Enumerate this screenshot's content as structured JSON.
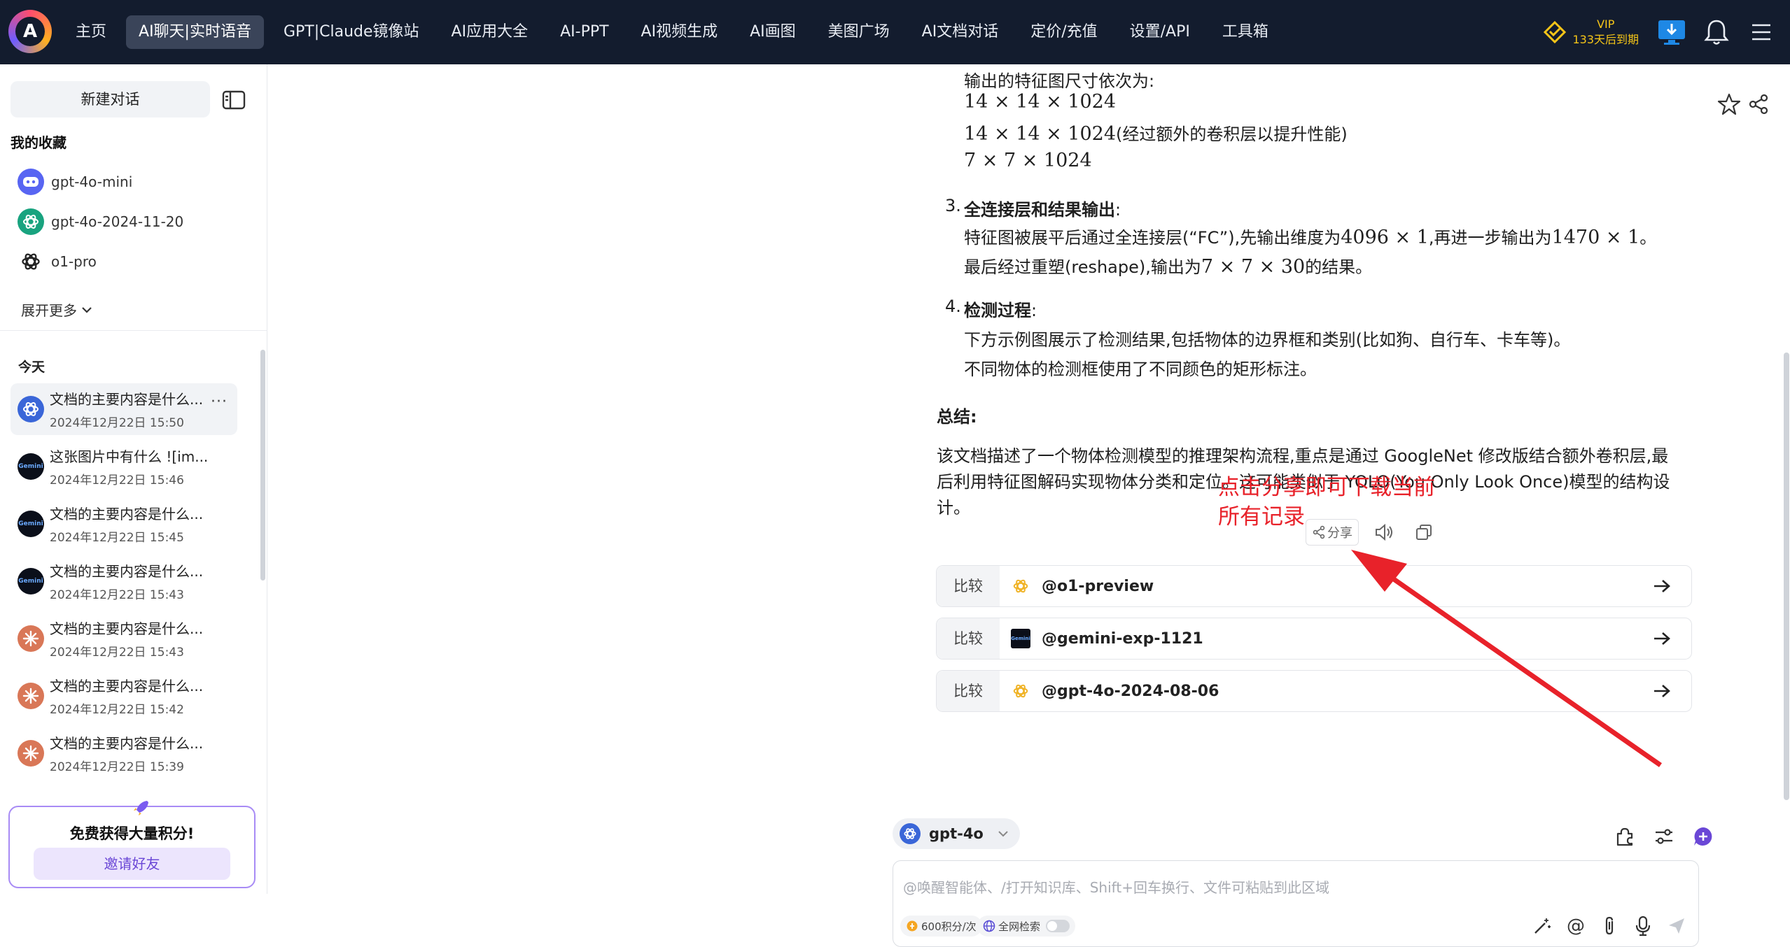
{
  "topnav": {
    "logo_letter": "A",
    "items": [
      {
        "label": "主页",
        "active": false
      },
      {
        "label": "AI聊天|实时语音",
        "active": true
      },
      {
        "label": "GPT|Claude镜像站",
        "active": false
      },
      {
        "label": "AI应用大全",
        "active": false
      },
      {
        "label": "AI-PPT",
        "active": false
      },
      {
        "label": "AI视频生成",
        "active": false
      },
      {
        "label": "AI画图",
        "active": false
      },
      {
        "label": "美图广场",
        "active": false
      },
      {
        "label": "AI文档对话",
        "active": false
      },
      {
        "label": "定价/充值",
        "active": false
      },
      {
        "label": "设置/API",
        "active": false
      },
      {
        "label": "工具箱",
        "active": false
      }
    ],
    "vip_label": "VIP",
    "vip_expiry": "133天后到期"
  },
  "sidebar": {
    "new_chat_label": "新建对话",
    "favorites_title": "我的收藏",
    "favorites": [
      {
        "label": "gpt-4o-mini",
        "icon": "discord-bot-icon"
      },
      {
        "label": "gpt-4o-2024-11-20",
        "icon": "openai-icon"
      },
      {
        "label": "o1-pro",
        "icon": "openai-icon"
      }
    ],
    "expand_more_label": "展开更多",
    "today_label": "今天",
    "history": [
      {
        "title": "文档的主要内容是什么...",
        "date": "2024年12月22日 15:50",
        "icon": "openai-icon",
        "selected": true
      },
      {
        "title": "这张图片中有什么 ![im...",
        "date": "2024年12月22日 15:46",
        "icon": "gemini-icon",
        "selected": false
      },
      {
        "title": "文档的主要内容是什么...",
        "date": "2024年12月22日 15:45",
        "icon": "gemini-icon",
        "selected": false
      },
      {
        "title": "文档的主要内容是什么...",
        "date": "2024年12月22日 15:43",
        "icon": "gemini-icon",
        "selected": false
      },
      {
        "title": "文档的主要内容是什么...",
        "date": "2024年12月22日 15:43",
        "icon": "claude-icon",
        "selected": false
      },
      {
        "title": "文档的主要内容是什么...",
        "date": "2024年12月22日 15:42",
        "icon": "claude-icon",
        "selected": false
      },
      {
        "title": "文档的主要内容是什么...",
        "date": "2024年12月22日 15:39",
        "icon": "claude-icon",
        "selected": false
      }
    ],
    "promo_title": "免费获得大量积分!",
    "promo_button": "邀请好友"
  },
  "message": {
    "l1": "输出的特征图尺寸依次为:",
    "l2": "14 × 14 × 1024",
    "l3a": "14 × 14 × 1024",
    "l3b": "(经过额外的卷积层以提升性能)",
    "l4": "7 × 7 × 1024",
    "n3": "3.",
    "h3": "全连接层和结果输出",
    "colon": ":",
    "p3a_1": "特征图被展平后通过全连接层(“FC”),先输出维度为",
    "p3a_m1": "4096 × 1",
    "p3a_2": ",再进一步输出为",
    "p3a_m2": "1470 × 1",
    "p3a_3": "。",
    "p3b_1": "最后经过重塑(reshape),输出为",
    "p3b_m": "7 × 7 × 30",
    "p3b_2": "的结果。",
    "n4": "4.",
    "h4": "检测过程",
    "p4a": "下方示例图展示了检测结果,包括物体的边界框和类别(比如狗、自行车、卡车等)。",
    "p4b": "不同物体的检测框使用了不同颜色的矩形标注。",
    "summary_title": "总结:",
    "s1": "该文档描述了一个物体检测模型的推理架构流程,重点是通过 GoogleNet 修改版结合额外卷积层,最",
    "s2": "后利用特征图解码实现物体分类和定位。这可能类似于 YOLO(You Only Look Once)模型的结构设",
    "s3": "计。",
    "share_label": "分享"
  },
  "compare": {
    "label": "比较",
    "items": [
      {
        "name": "@o1-preview",
        "icon": "openai-icon"
      },
      {
        "name": "@gemini-exp-1121",
        "icon": "gemini-icon"
      },
      {
        "name": "@gpt-4o-2024-08-06",
        "icon": "openai-icon"
      }
    ]
  },
  "composer": {
    "model": "gpt-4o",
    "placeholder": "@唤醒智能体、/打开知识库、Shift+回车换行、文件可粘贴到此区域",
    "points_label": "600积分/次",
    "web_search_label": "全网检索"
  },
  "annotation": {
    "text": "点击分享即可下载当前所有记录",
    "color": "#e8222a"
  }
}
